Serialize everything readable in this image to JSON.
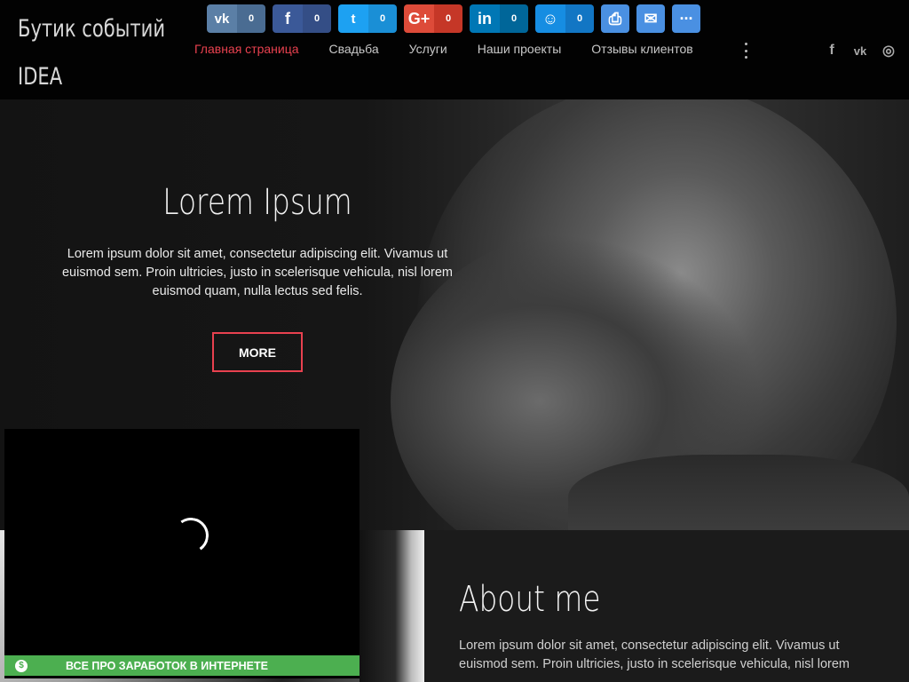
{
  "header": {
    "logo": "Бутик событий IDEA",
    "share_buttons": [
      {
        "name": "vk",
        "icon": "vk-icon",
        "glyph": "vk",
        "count": "0",
        "color": "#5b7fa6",
        "count_color": "#4a6c92"
      },
      {
        "name": "facebook",
        "icon": "facebook-icon",
        "glyph": "f",
        "count": "0",
        "color": "#3b5998",
        "count_color": "#344e86"
      },
      {
        "name": "twitter",
        "icon": "twitter-icon",
        "glyph": "t",
        "count": "0",
        "color": "#1da1f2",
        "count_color": "#1a8fd6"
      },
      {
        "name": "google-plus",
        "icon": "google-plus-icon",
        "glyph": "G+",
        "count": "0",
        "color": "#dd4b39",
        "count_color": "#c53727"
      },
      {
        "name": "linkedin",
        "icon": "linkedin-icon",
        "glyph": "in",
        "count": "0",
        "color": "#0077b5",
        "count_color": "#006699"
      },
      {
        "name": "moimir",
        "icon": "moimir-icon",
        "glyph": "☺",
        "count": "0",
        "color": "#168de2",
        "count_color": "#1276c4"
      },
      {
        "name": "print",
        "icon": "print-icon",
        "glyph": "⎙",
        "count": null,
        "color": "#4a90e2"
      },
      {
        "name": "email",
        "icon": "email-icon",
        "glyph": "✉",
        "count": null,
        "color": "#4a90e2"
      },
      {
        "name": "more",
        "icon": "more-icon",
        "glyph": "···",
        "count": null,
        "color": "#4a90e2"
      }
    ],
    "nav": [
      {
        "label": "Главная страница",
        "active": true
      },
      {
        "label": "Свадьба",
        "active": false
      },
      {
        "label": "Услуги",
        "active": false
      },
      {
        "label": "Наши проекты",
        "active": false
      },
      {
        "label": "Отзывы клиентов",
        "active": false
      }
    ],
    "social": [
      {
        "icon": "facebook-icon",
        "glyph": "f"
      },
      {
        "icon": "vk-icon",
        "glyph": "vk"
      },
      {
        "icon": "instagram-icon",
        "glyph": "◎"
      }
    ]
  },
  "hero": {
    "title": "Lorem Ipsum",
    "text": "Lorem ipsum dolor sit amet, consectetur adipiscing elit. Vivamus ut euismod sem. Proin ultricies, justo in scelerisque vehicula, nisl lorem euismod quam, nulla lectus sed felis.",
    "button": "MORE"
  },
  "about": {
    "title": "About me",
    "text": "Lorem ipsum dolor sit amet, consectetur adipiscing elit. Vivamus ut euismod sem. Proin ultricies, justo in scelerisque vehicula, nisl lorem"
  },
  "video_popup": {
    "bar_text": "ВСЕ ПРО ЗАРАБОТОК В ИНТЕРНЕТЕ",
    "coin_glyph": "$"
  },
  "colors": {
    "accent": "#e8414f",
    "background": "#000000",
    "video_bar": "#4caf50"
  }
}
